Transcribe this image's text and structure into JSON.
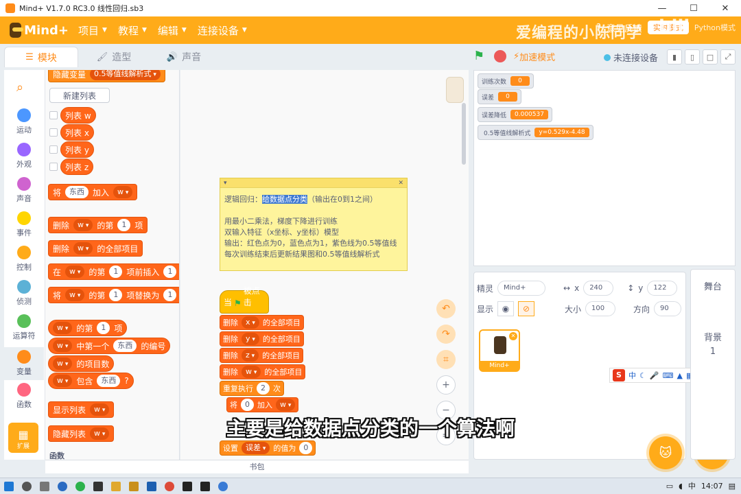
{
  "window": {
    "title": "Mind+ V1.7.0 RC3.0   线性回归.sb3",
    "controls": [
      "—",
      "☐",
      "✕"
    ]
  },
  "menubar": {
    "logo": "Mind+",
    "items": [
      "项目",
      "教程",
      "编辑",
      "连接设备"
    ],
    "help": "意见反馈",
    "mode": "实时模式",
    "python": "Python模式"
  },
  "watermark": {
    "text": "爱编程的小陈同学",
    "brand": "bilibili"
  },
  "tabs": [
    {
      "label": "模块",
      "icon": "☰"
    },
    {
      "label": "造型",
      "icon": "🖌"
    },
    {
      "label": "声音",
      "icon": "🔊"
    }
  ],
  "run": {
    "turbo": "加速模式",
    "connection": "未连接设备"
  },
  "categories": [
    {
      "label": "运动",
      "color": "#4c97ff"
    },
    {
      "label": "外观",
      "color": "#9966ff"
    },
    {
      "label": "声音",
      "color": "#cf63cf"
    },
    {
      "label": "事件",
      "color": "#ffd500"
    },
    {
      "label": "控制",
      "color": "#ffab19"
    },
    {
      "label": "侦测",
      "color": "#5cb1d6"
    },
    {
      "label": "运算符",
      "color": "#59c059"
    },
    {
      "label": "变量",
      "color": "#ff8c1a"
    },
    {
      "label": "函数",
      "color": "#ff6680"
    }
  ],
  "extension": {
    "label": "扩展"
  },
  "palette": {
    "hide_var": "隐藏变量",
    "hide_var_value": "0.5等值线解析式",
    "new_list": "新建列表",
    "lists": [
      "列表 w",
      "列表 x",
      "列表 y",
      "列表 z"
    ],
    "add": {
      "a": "将",
      "item": "东西",
      "b": "加入",
      "list": "w"
    },
    "delete_nth": {
      "a": "删除",
      "list": "w",
      "b": "的第",
      "n": "1",
      "c": "项"
    },
    "delete_all": {
      "a": "删除",
      "list": "w",
      "b": "的全部项目"
    },
    "insert": {
      "a": "在",
      "list": "w",
      "b": "的第",
      "n": "1",
      "c": "项前插入",
      "v": "1"
    },
    "replace": {
      "a": "将",
      "list": "w",
      "b": "的第",
      "n": "1",
      "c": "项替换为",
      "v": "1"
    },
    "item_of": {
      "list": "w",
      "a": "的第",
      "n": "1",
      "b": "项"
    },
    "index_of": {
      "list": "w",
      "a": "中第一个",
      "item": "东西",
      "b": "的编号"
    },
    "length": {
      "list": "w",
      "a": "的项目数"
    },
    "contains": {
      "list": "w",
      "a": "包含",
      "item": "东西",
      "b": "?"
    },
    "show_list": {
      "a": "显示列表",
      "list": "w"
    },
    "hide_list": {
      "a": "隐藏列表",
      "list": "w"
    },
    "section": "函数"
  },
  "comment": {
    "line1_pre": "逻辑回归：",
    "line1_hl": "给数据点分类",
    "line1_post": "（输出在0到1之间）",
    "line2": "用最小二乘法，梯度下降进行训练",
    "line3": "双输入特征（x坐标、y坐标）模型",
    "line4": "输出：红色点为0，蓝色点为1，紫色线为0.5等值线",
    "line5": "每次训练结束后更新结果图和0.5等值线解析式"
  },
  "script": {
    "hat_a": "当",
    "hat_b": "被点击",
    "blocks": [
      {
        "a": "删除",
        "list": "x",
        "b": "的全部项目"
      },
      {
        "a": "删除",
        "list": "y",
        "b": "的全部项目"
      },
      {
        "a": "删除",
        "list": "z",
        "b": "的全部项目"
      },
      {
        "a": "删除",
        "list": "w",
        "b": "的全部项目"
      }
    ],
    "repeat": {
      "a": "重复执行",
      "n": "2",
      "b": "次"
    },
    "add_inner": {
      "a": "将",
      "v": "0",
      "b": "加入",
      "list": "w"
    },
    "set": {
      "a": "设置",
      "var": "误差",
      "b": "的值为",
      "v": "0"
    }
  },
  "bookbar": "书包",
  "monitors": [
    {
      "label": "训练次数",
      "value": "0"
    },
    {
      "label": "误差",
      "value": "0"
    },
    {
      "label": "误差降低",
      "value": "0.000537"
    },
    {
      "label": "0.5等值线解析式",
      "value": "y=0.529x-4.48"
    }
  ],
  "sprite": {
    "label": "精灵",
    "name": "Mind+",
    "x": "240",
    "y": "122",
    "show": "显示",
    "size_label": "大小",
    "size": "100",
    "direction_label": "方向",
    "direction": "90"
  },
  "stage_col": {
    "title": "舞台",
    "backdrop": "背景",
    "count": "1"
  },
  "ime": {
    "logo": "S",
    "lang": "中"
  },
  "subtitle": "主要是给数据点分类的一个算法啊",
  "taskbar": {
    "time": "14:07",
    "lang": "中"
  }
}
